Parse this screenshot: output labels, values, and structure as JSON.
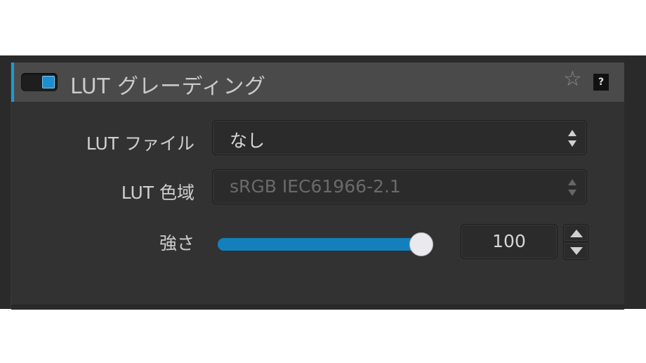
{
  "header": {
    "title": "LUT グレーディング",
    "enabled": true,
    "help_label": "?"
  },
  "fields": {
    "lut_file": {
      "label": "LUT ファイル",
      "value": "なし"
    },
    "lut_gamut": {
      "label": "LUT 色域",
      "value": "sRGB IEC61966-2.1",
      "disabled": true
    },
    "strength": {
      "label": "強さ",
      "value": "100",
      "fraction": 1.0
    }
  },
  "icons": {
    "favorite": "star-outline-icon",
    "help": "help-icon",
    "select_arrows": "up-down-chevron-icon",
    "stepper": "increment-decrement-icon"
  },
  "colors": {
    "accent": "#1d9ad6",
    "slider_fill": "#1380bd",
    "header_bg": "#4a4a4a",
    "panel_bg": "#323232"
  }
}
